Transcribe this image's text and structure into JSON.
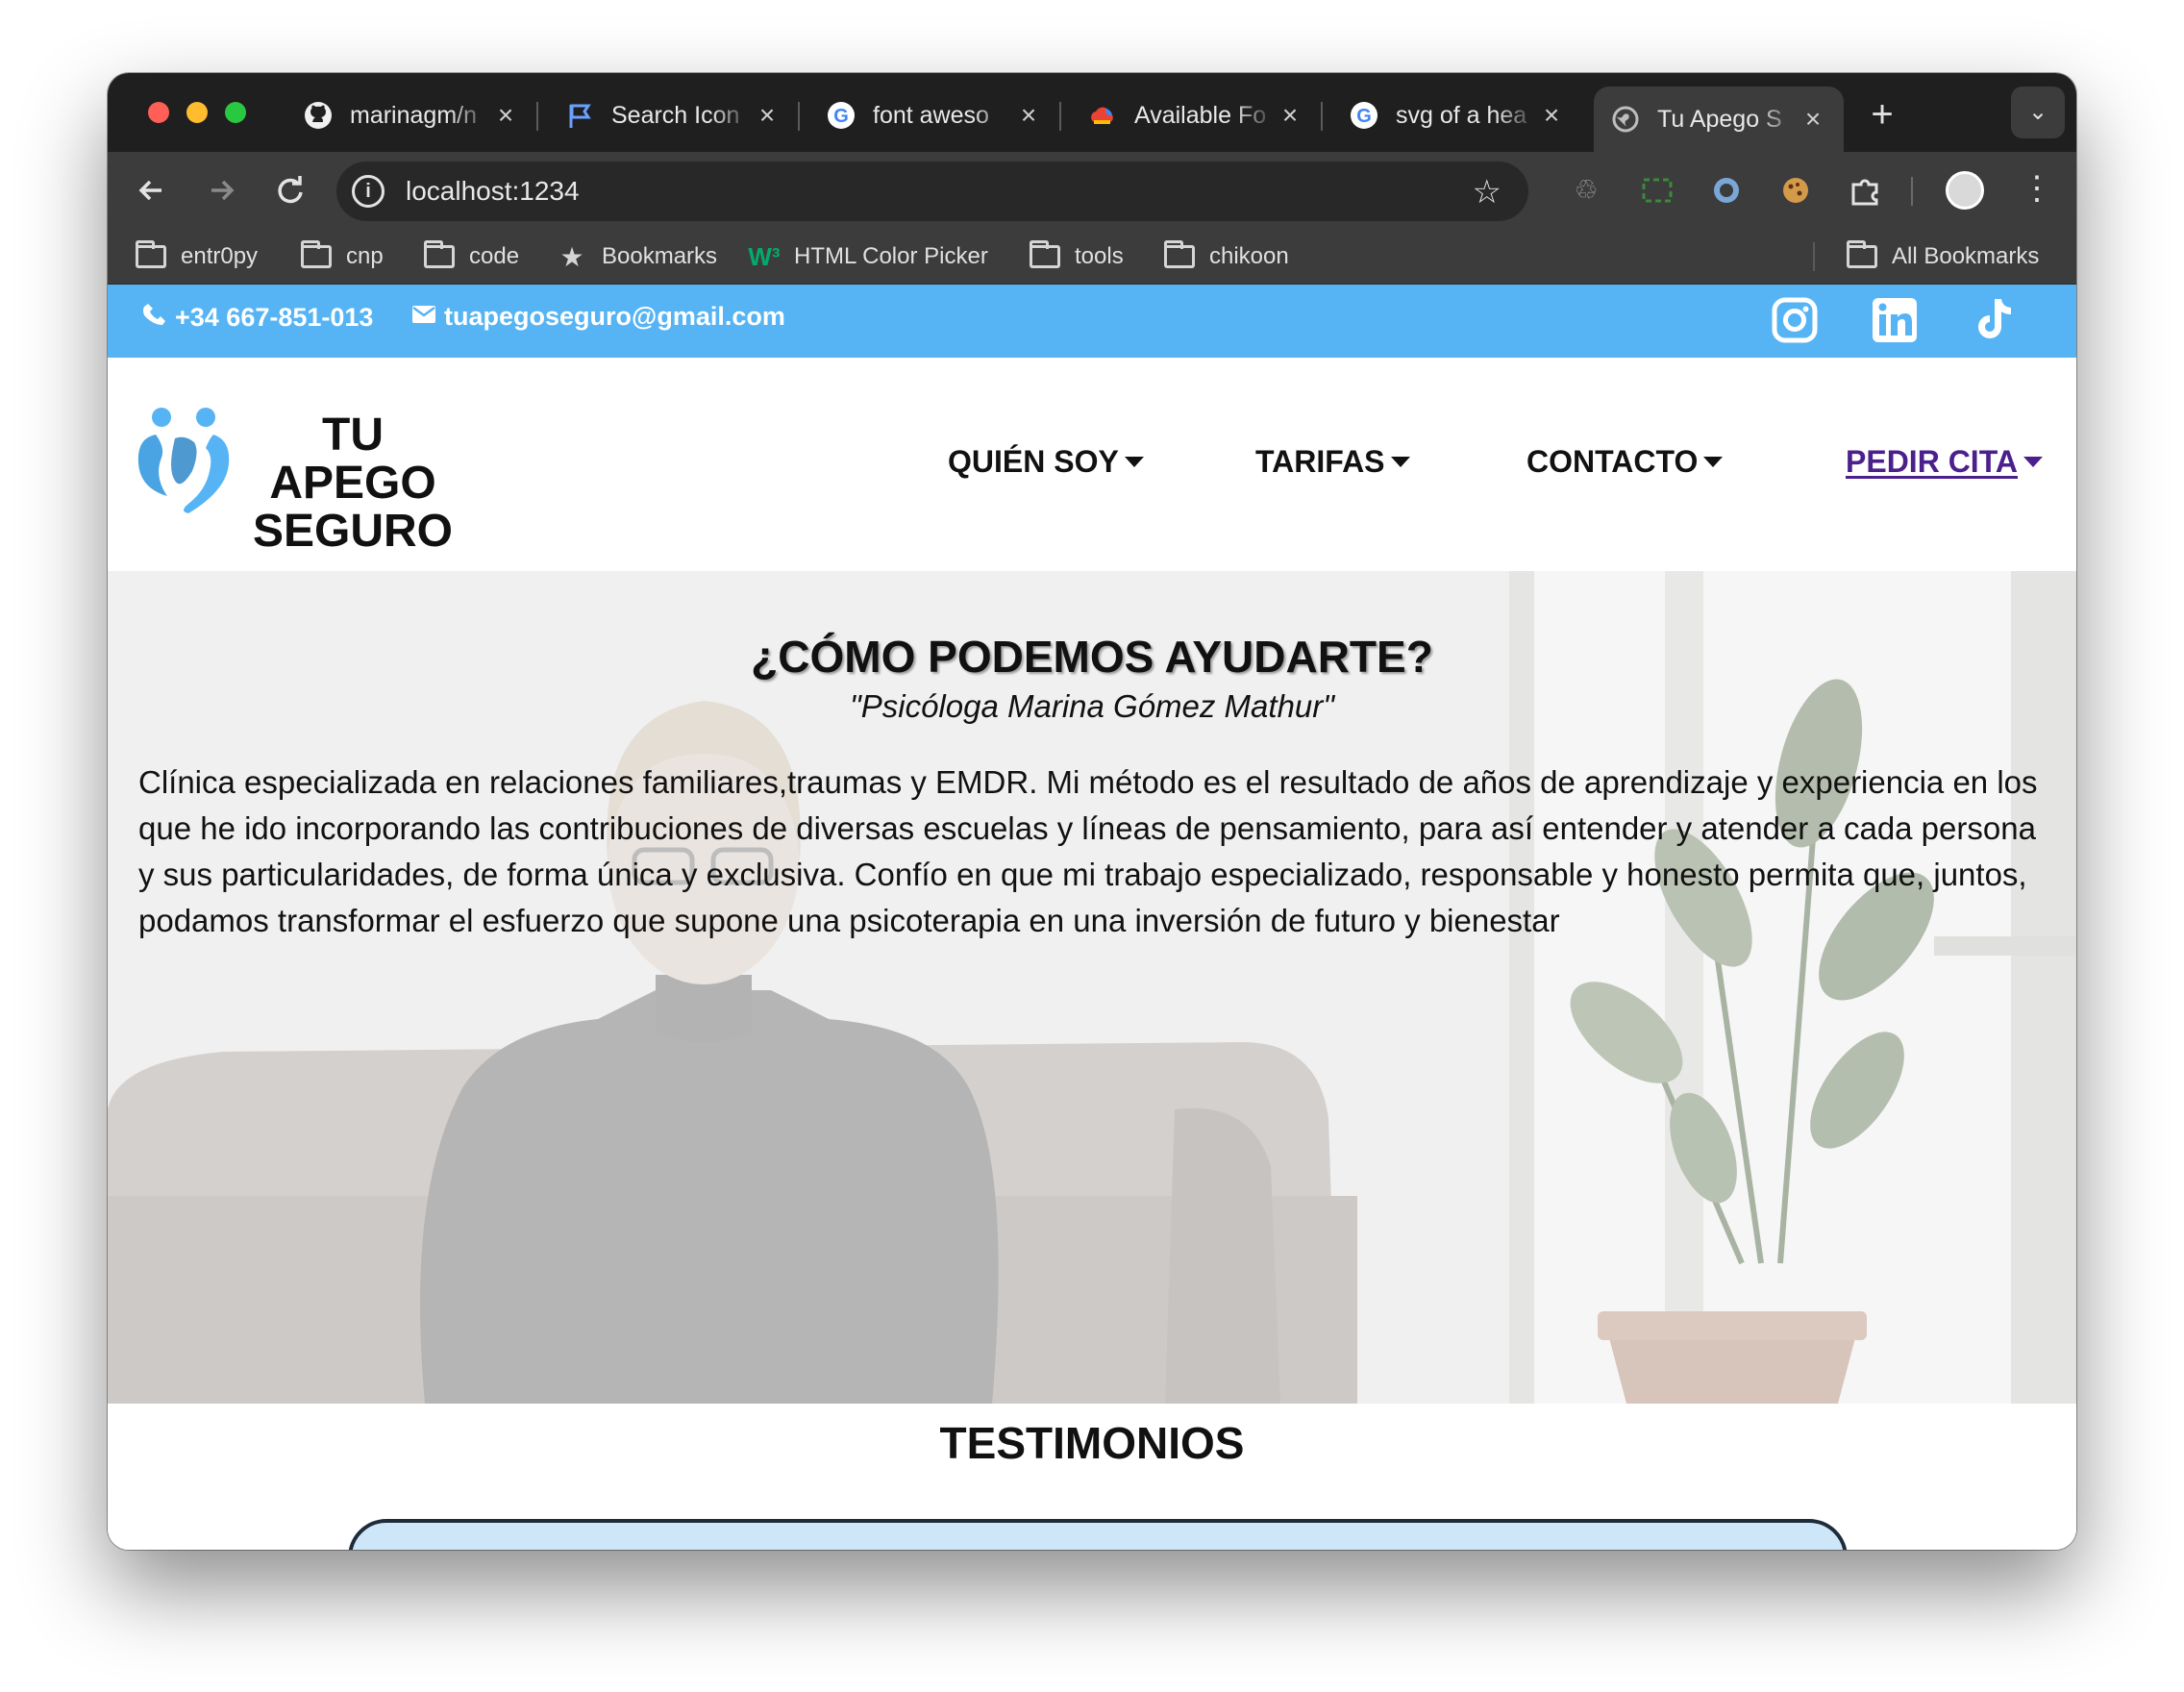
{
  "browser": {
    "tabs": [
      {
        "label": "marinagm/n",
        "icon": "github-icon"
      },
      {
        "label": "Search Icon",
        "icon": "flag-icon"
      },
      {
        "label": "font aweso",
        "icon": "google-icon"
      },
      {
        "label": "Available Fo",
        "icon": "google-cloud-icon"
      },
      {
        "label": "svg of a hea",
        "icon": "google-icon"
      },
      {
        "label": "Tu Apego S",
        "icon": "globe-icon",
        "active": true
      }
    ],
    "new_tab": "+",
    "url": "localhost:1234",
    "bookmarks": [
      {
        "label": "entr0py",
        "icon": "folder-icon"
      },
      {
        "label": "cnp",
        "icon": "folder-icon"
      },
      {
        "label": "code",
        "icon": "folder-icon"
      },
      {
        "label": "Bookmarks",
        "icon": "star-icon"
      },
      {
        "label": "HTML Color Picker",
        "icon": "w3schools-icon"
      },
      {
        "label": "tools",
        "icon": "folder-icon"
      },
      {
        "label": "chikoon",
        "icon": "folder-icon"
      }
    ],
    "all_bookmarks": "All Bookmarks"
  },
  "contact": {
    "phone": "+34 667-851-013",
    "email": "tuapegoseguro@gmail.com",
    "social": [
      "instagram-icon",
      "linkedin-icon",
      "tiktok-icon"
    ]
  },
  "brand": {
    "line1": "TU APEGO",
    "line2": "SEGURO",
    "logo_color": "#56b4f5"
  },
  "nav": {
    "items": [
      "QUIÉN SOY",
      "TARIFAS",
      "CONTACTO"
    ],
    "cta": "PEDIR CITA"
  },
  "hero": {
    "title": "¿CÓMO PODEMOS AYUDARTE?",
    "subtitle": "\"Psicóloga Marina Gómez Mathur\"",
    "body": "Clínica especializada en relaciones familiares,traumas y EMDR. Mi método es el resultado de años de aprendizaje y experiencia en los que he ido incorporando las contribuciones de diversas escuelas y líneas de pensamiento, para así entender y atender a cada persona y sus particularidades, de forma única y exclusiva. Confío en que mi trabajo especializado, responsable y honesto permita que, juntos, podamos transformar el esfuerzo que supone una psicoterapia en una inversión de futuro y bienestar"
  },
  "testimonials": {
    "heading": "TESTIMONIOS"
  },
  "colors": {
    "contact_bar": "#56b4f5",
    "cta": "#4b1f8c",
    "chrome_dark": "#1f1f1f",
    "chrome_toolbar": "#3c3c3c"
  }
}
